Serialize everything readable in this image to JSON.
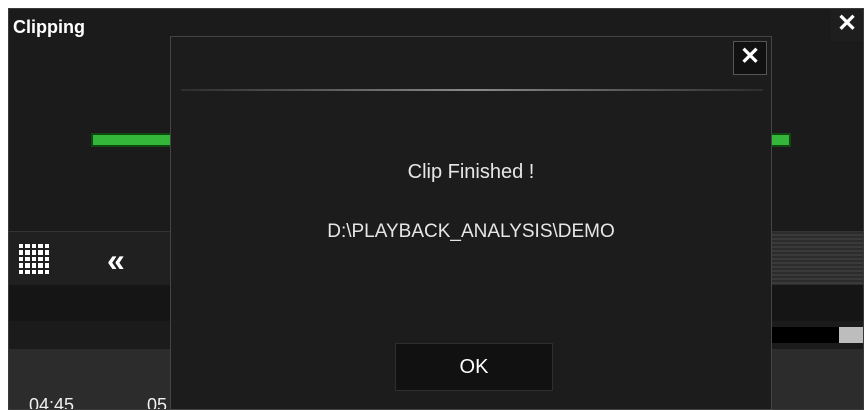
{
  "window": {
    "title": "Clipping",
    "close_label": "✕"
  },
  "toolbar": {
    "grid_icon": "grid-icon",
    "rewind_label": "«"
  },
  "timeline": {
    "times": [
      "04:45",
      "05"
    ]
  },
  "progress": {
    "color": "#34b63a"
  },
  "dialog": {
    "message": "Clip Finished !",
    "path": "D:\\PLAYBACK_ANALYSIS\\DEMO",
    "ok_label": "OK",
    "close_label": "✕"
  }
}
